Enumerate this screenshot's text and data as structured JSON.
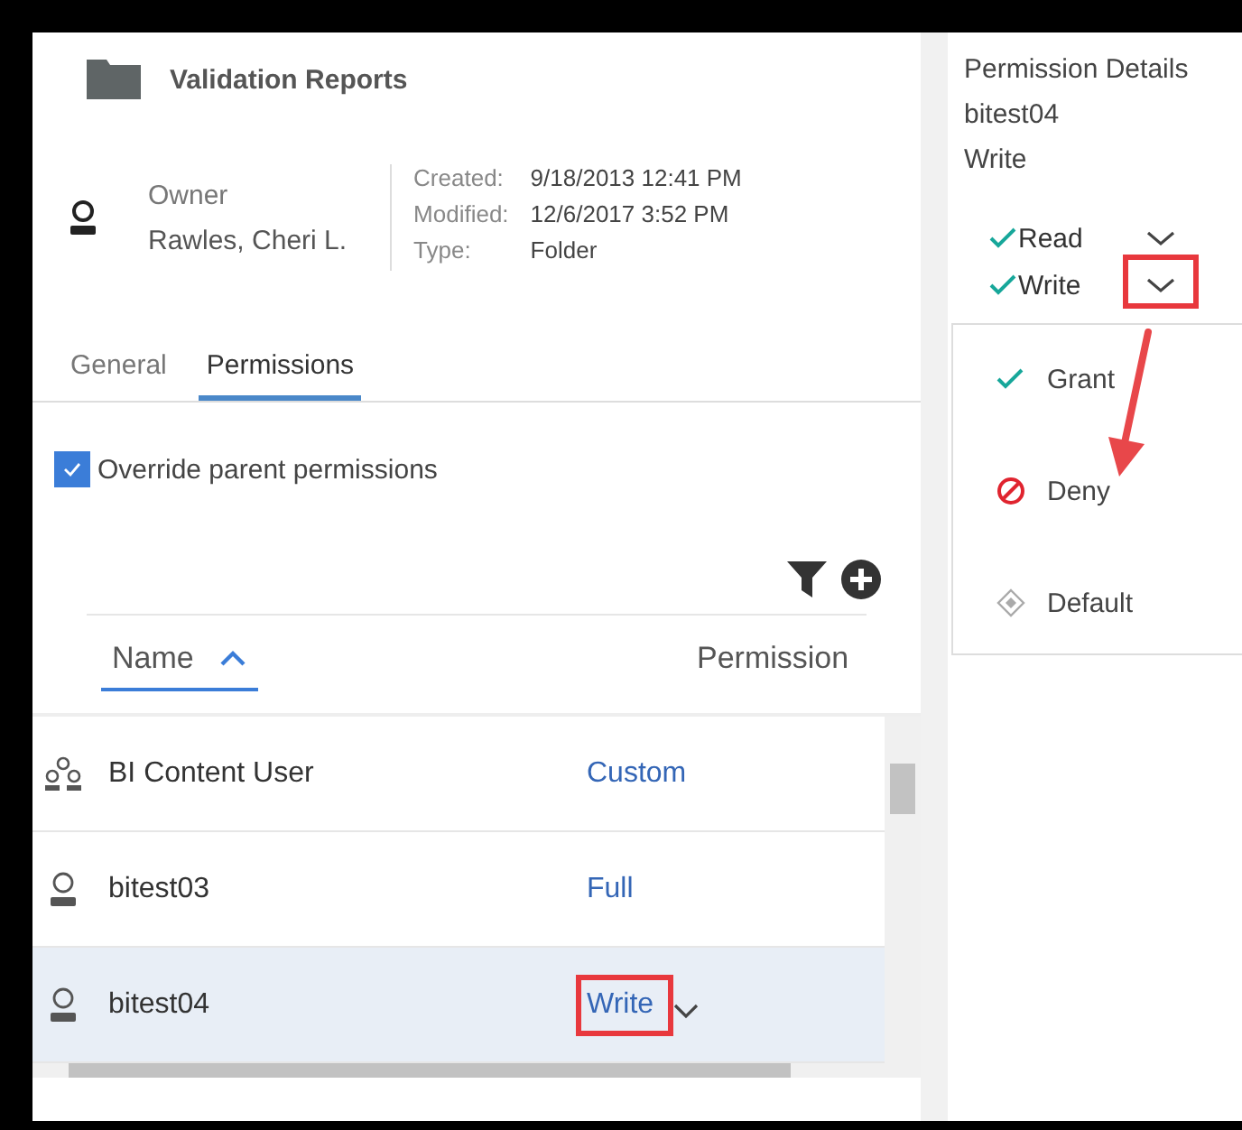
{
  "folder": {
    "title": "Validation Reports"
  },
  "owner": {
    "label": "Owner",
    "name": "Rawles, Cheri L."
  },
  "meta": [
    {
      "label": "Created:",
      "value": "9/18/2013 12:41 PM"
    },
    {
      "label": "Modified:",
      "value": "12/6/2017 3:52 PM"
    },
    {
      "label": "Type:",
      "value": "Folder"
    }
  ],
  "tabs": [
    {
      "label": "General",
      "selected": false
    },
    {
      "label": "Permissions",
      "selected": true
    }
  ],
  "override": {
    "label": "Override parent permissions",
    "checked": true
  },
  "table": {
    "columns": [
      {
        "label": "Name",
        "sorted": true
      },
      {
        "label": "Permission",
        "sorted": false
      }
    ],
    "rows": [
      {
        "kind": "group",
        "name": "BI Content User",
        "permission": "Custom",
        "selected": false
      },
      {
        "kind": "user",
        "name": "bitest03",
        "permission": "Full",
        "selected": false
      },
      {
        "kind": "user",
        "name": "bitest04",
        "permission": "Write",
        "selected": true
      }
    ]
  },
  "details": {
    "title": "Permission Details",
    "user": "bitest04",
    "permission": "Write",
    "capabilities": [
      {
        "label": "Read",
        "granted": true,
        "highlighted": false
      },
      {
        "label": "Write",
        "granted": true,
        "highlighted": true
      }
    ],
    "menu": [
      {
        "kind": "grant",
        "label": "Grant"
      },
      {
        "kind": "deny",
        "label": "Deny"
      },
      {
        "kind": "default",
        "label": "Default"
      }
    ]
  }
}
